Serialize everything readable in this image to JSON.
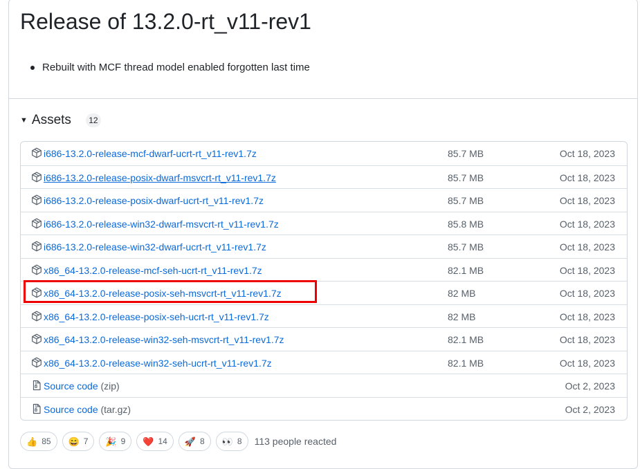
{
  "release": {
    "title": "Release of 13.2.0-rt_v11-rev1",
    "notes": [
      "Rebuilt with MCF thread model enabled forgotten last time"
    ]
  },
  "assets": {
    "title": "Assets",
    "count": "12",
    "items": [
      {
        "name": "i686-13.2.0-release-mcf-dwarf-ucrt-rt_v11-rev1.7z",
        "size": "85.7 MB",
        "date": "Oct 18, 2023",
        "icon": "package-icon"
      },
      {
        "name": "i686-13.2.0-release-posix-dwarf-msvcrt-rt_v11-rev1.7z",
        "size": "85.7 MB",
        "date": "Oct 18, 2023",
        "icon": "package-icon",
        "hovered": true
      },
      {
        "name": "i686-13.2.0-release-posix-dwarf-ucrt-rt_v11-rev1.7z",
        "size": "85.7 MB",
        "date": "Oct 18, 2023",
        "icon": "package-icon"
      },
      {
        "name": "i686-13.2.0-release-win32-dwarf-msvcrt-rt_v11-rev1.7z",
        "size": "85.8 MB",
        "date": "Oct 18, 2023",
        "icon": "package-icon"
      },
      {
        "name": "i686-13.2.0-release-win32-dwarf-ucrt-rt_v11-rev1.7z",
        "size": "85.7 MB",
        "date": "Oct 18, 2023",
        "icon": "package-icon"
      },
      {
        "name": "x86_64-13.2.0-release-mcf-seh-ucrt-rt_v11-rev1.7z",
        "size": "82.1 MB",
        "date": "Oct 18, 2023",
        "icon": "package-icon"
      },
      {
        "name": "x86_64-13.2.0-release-posix-seh-msvcrt-rt_v11-rev1.7z",
        "size": "82 MB",
        "date": "Oct 18, 2023",
        "icon": "package-icon"
      },
      {
        "name": "x86_64-13.2.0-release-posix-seh-ucrt-rt_v11-rev1.7z",
        "size": "82 MB",
        "date": "Oct 18, 2023",
        "icon": "package-icon"
      },
      {
        "name": "x86_64-13.2.0-release-win32-seh-msvcrt-rt_v11-rev1.7z",
        "size": "82.1 MB",
        "date": "Oct 18, 2023",
        "icon": "package-icon"
      },
      {
        "name": "x86_64-13.2.0-release-win32-seh-ucrt-rt_v11-rev1.7z",
        "size": "82.1 MB",
        "date": "Oct 18, 2023",
        "icon": "package-icon"
      },
      {
        "name": "Source code",
        "suffix": "(zip)",
        "size": "",
        "date": "Oct 2, 2023",
        "icon": "file-zip-icon"
      },
      {
        "name": "Source code",
        "suffix": "(tar.gz)",
        "size": "",
        "date": "Oct 2, 2023",
        "icon": "file-zip-icon"
      }
    ]
  },
  "highlight": {
    "target": "x86_64-13.2.0-release-posix-seh-msvcrt-rt_v11-rev1.7z",
    "color": "#ee0000"
  },
  "reactions": {
    "items": [
      {
        "emoji": "👍",
        "name": "thumbs-up",
        "count": "85"
      },
      {
        "emoji": "😄",
        "name": "laugh",
        "count": "7"
      },
      {
        "emoji": "🎉",
        "name": "hooray",
        "count": "9"
      },
      {
        "emoji": "❤️",
        "name": "heart",
        "count": "14"
      },
      {
        "emoji": "🚀",
        "name": "rocket",
        "count": "8"
      },
      {
        "emoji": "👀",
        "name": "eyes",
        "count": "8"
      }
    ],
    "summary": "113 people reacted"
  },
  "colors": {
    "link": "#0969da",
    "muted": "#57606a",
    "border": "#d0d7de",
    "text": "#1f2328"
  }
}
